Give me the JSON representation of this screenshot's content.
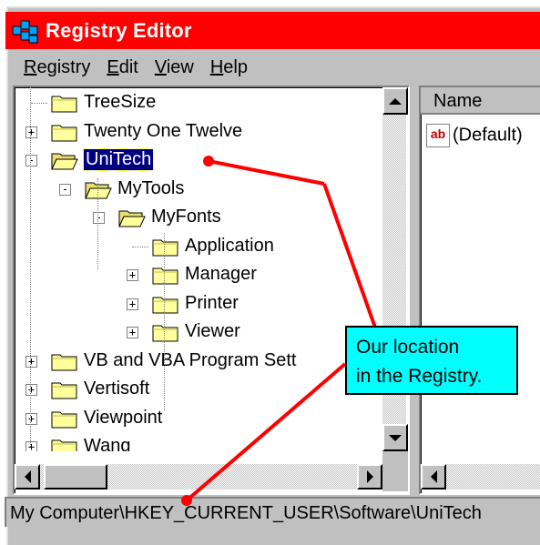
{
  "window": {
    "title": "Registry Editor",
    "icon": "registry-editor-icon"
  },
  "menubar": {
    "items": [
      {
        "label": "Registry",
        "underline": "R",
        "rest": "egistry"
      },
      {
        "label": "Edit",
        "underline": "E",
        "rest": "dit"
      },
      {
        "label": "View",
        "underline": "V",
        "rest": "iew"
      },
      {
        "label": "Help",
        "underline": "H",
        "rest": "elp"
      }
    ]
  },
  "tree": {
    "items": [
      {
        "label": "TreeSize",
        "expander": "",
        "open": false
      },
      {
        "label": "Twenty One Twelve",
        "expander": "+",
        "open": false
      },
      {
        "label": "UniTech",
        "expander": "−",
        "open": true,
        "selected": true
      },
      {
        "label": "MyTools",
        "expander": "−",
        "open": true
      },
      {
        "label": "MyFonts",
        "expander": "−",
        "open": true
      },
      {
        "label": "Application",
        "expander": "",
        "open": false
      },
      {
        "label": "Manager",
        "expander": "+",
        "open": false
      },
      {
        "label": "Printer",
        "expander": "+",
        "open": false
      },
      {
        "label": "Viewer",
        "expander": "+",
        "open": false
      },
      {
        "label": "VB and VBA Program Sett",
        "expander": "+",
        "open": false
      },
      {
        "label": "Vertisoft",
        "expander": "+",
        "open": false
      },
      {
        "label": "Viewpoint",
        "expander": "+",
        "open": false
      },
      {
        "label": "Wang",
        "expander": "+",
        "open": false
      }
    ]
  },
  "list": {
    "column_name": "Name",
    "rows": [
      {
        "icon": "string-value-icon",
        "icon_text": "ab",
        "name": "(Default)"
      }
    ]
  },
  "statusbar": {
    "text": "My Computer\\HKEY_CURRENT_USER\\Software\\UniTech"
  },
  "callout": {
    "line1": "Our location",
    "line2": "in the Registry."
  },
  "colors": {
    "titlebar": "#ff0000",
    "callout": "#00ffff",
    "selection": "#000080",
    "annotation_line": "#ff0000"
  }
}
